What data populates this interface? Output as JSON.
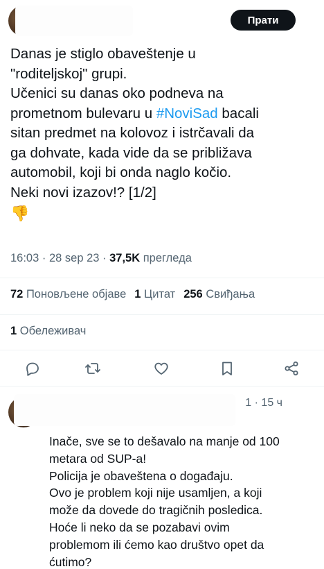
{
  "tweet": {
    "follow_label": "Прати",
    "lines": [
      "Danas je stiglo obaveštenje u",
      "\"roditeljskoj\" grupi.",
      "Učenici su danas oko podneva na",
      "prometnom bulevaru u ",
      "sitan predmet na kolovoz i istrčavali da",
      "ga dohvate, kada vide da se približava",
      "automobil, koji bi onda naglo kočio.",
      "Neki novi izazov!? [1/2]"
    ],
    "hashtag": "#NoviSad",
    "after_hashtag": " bacali",
    "emoji": "👎",
    "time": "16:03 · 28 sep 23 · ",
    "views_count": "37,5K",
    "views_label": " прегледа"
  },
  "stats": {
    "reposts_count": "72",
    "reposts_label": " Поновљене објаве",
    "quotes_count": "1",
    "quotes_label": " Цитат",
    "likes_count": "256",
    "likes_label": " Свиђања",
    "bookmarks_count": "1",
    "bookmarks_label": " Обележивач"
  },
  "actions": {
    "icons": [
      "reply-icon",
      "repost-icon",
      "like-icon",
      "bookmark-icon",
      "share-icon"
    ],
    "color": "#536471"
  },
  "reply": {
    "time": "1 · 15 ч",
    "more": "···",
    "lines": [
      "Inače, sve se to dešavalo na manje od 100",
      "metara od SUP-a!",
      "Policija je obaveštena o događaju.",
      "Ovo je problem koji nije usamljen, a koji",
      "može da dovede do tragičnih posledica.",
      "Hoće li neko da se pozabavi ovim",
      "problemom ili ćemo kao društvo opet da",
      "ćutimo?"
    ]
  },
  "colors": {
    "text": "#0f1419",
    "secondary": "#536471",
    "link": "#1d9bf0",
    "button_bg": "#0f1419"
  }
}
